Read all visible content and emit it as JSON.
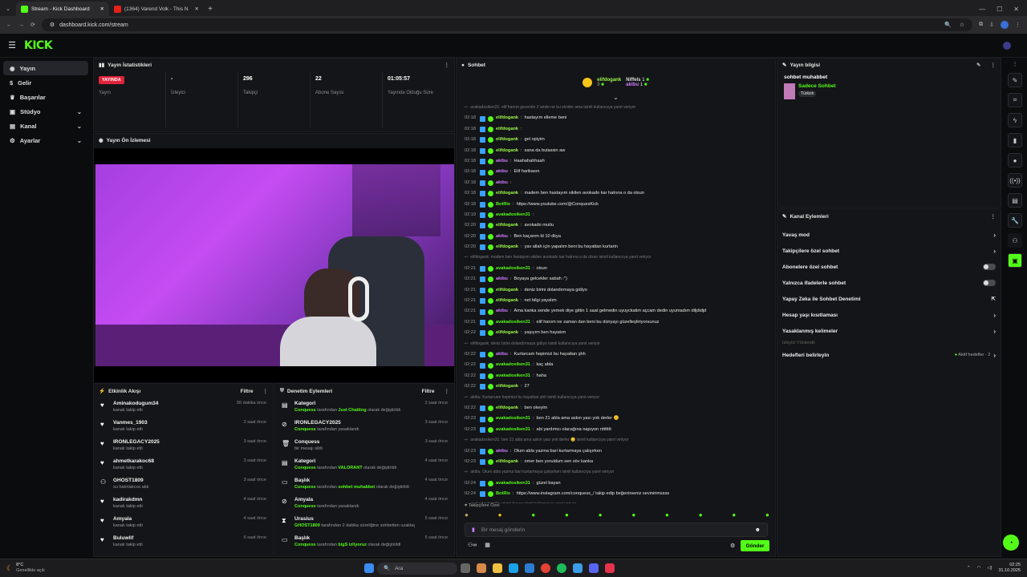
{
  "browser": {
    "tabs": [
      {
        "label": "Stream - Kick Dashboard",
        "active": true,
        "icon": "kick-icon"
      },
      {
        "label": "(1364) Varend Volk - This N",
        "active": false,
        "icon": "youtube-icon"
      }
    ],
    "url": "dashboard.kick.com/stream"
  },
  "header": {
    "logo": "KICK"
  },
  "sidebar": {
    "items": [
      {
        "label": "Yayın",
        "active": true,
        "chevron": false
      },
      {
        "label": "Gelir",
        "active": false,
        "chevron": false
      },
      {
        "label": "Başarılar",
        "active": false,
        "chevron": false
      },
      {
        "label": "Stüdyo",
        "active": false,
        "chevron": true
      },
      {
        "label": "Kanal",
        "active": false,
        "chevron": true
      },
      {
        "label": "Ayarlar",
        "active": false,
        "chevron": true
      }
    ]
  },
  "stats": {
    "title": "Yayın İstatistikleri",
    "items": [
      {
        "value": "YAYINDA",
        "label": "Yayın",
        "is_badge": true
      },
      {
        "value": "-",
        "label": "İzleyici"
      },
      {
        "value": "296",
        "label": "Takipçi"
      },
      {
        "value": "22",
        "label": "Abone Sayısı"
      },
      {
        "value": "01:05:57",
        "label": "Yayında Olduğu Süre"
      }
    ]
  },
  "preview": {
    "title": "Yayın Ön İzlemesi"
  },
  "activity": {
    "title": "Etkinlik Akışı",
    "filter": "Filtre",
    "items": [
      {
        "name": "Aminakodugum34",
        "sub": "kanalı takip etti",
        "time": "56 dakika önce",
        "icon": "heart-icon"
      },
      {
        "name": "Vanmes_1903",
        "sub": "kanalı takip etti",
        "time": "2 saat önce",
        "icon": "heart-icon"
      },
      {
        "name": "IRONLEGACY2025",
        "sub": "kanalı takip etti",
        "time": "3 saat önce",
        "icon": "heart-icon"
      },
      {
        "name": "ahmetkarakoc68",
        "sub": "kanalı takip etti",
        "time": "3 saat önce",
        "icon": "heart-icon"
      },
      {
        "name": "GHOST1809",
        "sub": "su hatırlatıcısı aldı",
        "time": "3 saat önce",
        "icon": "reward-icon"
      },
      {
        "name": "kadirakdmn",
        "sub": "kanalı takip etti",
        "time": "4 saat önce",
        "icon": "heart-icon"
      },
      {
        "name": "Amyala",
        "sub": "kanalı takip etti",
        "time": "4 saat önce",
        "icon": "heart-icon"
      },
      {
        "name": "Buluwlif",
        "sub": "kanalı takip etti",
        "time": "6 saat önce",
        "icon": "heart-icon"
      }
    ]
  },
  "moderation": {
    "title": "Denetim Eylemleri",
    "filter": "Filtre",
    "items": [
      {
        "name": "Kategori",
        "pre": "Conquess",
        "mid": " tarafından ",
        "hl": "Just Chatting",
        "post": " olarak değiştirildi",
        "time": "2 saat önce",
        "icon": "category-icon"
      },
      {
        "name": "IRONLEGACY2025",
        "pre": "Conquess",
        "mid": " tarafından yasaklandı",
        "hl": "",
        "post": "",
        "time": "3 saat önce",
        "icon": "ban-icon"
      },
      {
        "name": "Conquess",
        "pre": "",
        "mid": "bir mesajı sildi",
        "hl": "",
        "post": "",
        "time": "3 saat önce",
        "icon": "trash-icon"
      },
      {
        "name": "Kategori",
        "pre": "Conquess",
        "mid": " tarafından ",
        "hl": "VALORANT",
        "post": " olarak değiştirildi",
        "time": "4 saat önce",
        "icon": "category-icon"
      },
      {
        "name": "Başlık",
        "pre": "Conquess",
        "mid": " tarafından ",
        "hl": "sohbet muhabbet",
        "post": " olarak değiştirildi",
        "time": "4 saat önce",
        "icon": "title-icon"
      },
      {
        "name": "Amyala",
        "pre": "Conquess",
        "mid": " tarafından yasaklandı",
        "hl": "",
        "post": "",
        "time": "4 saat önce",
        "icon": "ban-icon"
      },
      {
        "name": "Urasius",
        "pre": "GHOST1809",
        "mid": " tarafından 2 dakika süreliğine sohbetten uzaklaştırıldı",
        "hl": "",
        "post": "",
        "time": "5 saat önce",
        "icon": "timeout-icon"
      },
      {
        "name": "Başlık",
        "pre": "Conquess",
        "mid": " tarafından ",
        "hl": "bigS izliyoruz",
        "post": " olarak değiştirildi",
        "time": "5 saat önce",
        "icon": "title-icon"
      }
    ]
  },
  "chat": {
    "title": "Sohbet",
    "leaders": [
      {
        "name": "elifdogank",
        "count": "3"
      },
      {
        "name": "Niffels",
        "count": "1"
      },
      {
        "name": "aktbu",
        "count": "1"
      }
    ],
    "messages": [
      {
        "sys": "avakadosiken31: elif hanım gecerdin 2 amile ne bu elcider ama isimli kullanıcıya yanıt veriyor"
      },
      {
        "time": "02:18",
        "user": "elifdogank",
        "u": "u1",
        "text": "hastayım elleme beni"
      },
      {
        "time": "02:18",
        "user": "elifdogank",
        "u": "u1",
        "text": ""
      },
      {
        "time": "02:18",
        "user": "elifdogank",
        "u": "u1",
        "text": "gel opiyim"
      },
      {
        "time": "02:18",
        "user": "elifdogank",
        "u": "u1",
        "text": "sana da bulassin aw"
      },
      {
        "time": "02:18",
        "user": "aktbu",
        "u": "u2",
        "text": "Haahahahhaah"
      },
      {
        "time": "02:18",
        "user": "aktbu",
        "u": "u2",
        "text": "Elif harikasın"
      },
      {
        "time": "02:18",
        "user": "aktbu",
        "u": "u2",
        "text": ""
      },
      {
        "time": "02:18",
        "user": "elifdogank",
        "u": "u1",
        "text": "madem ben hastayım sikilen avokado kar hatrına o da olsun"
      },
      {
        "time": "02:18",
        "user": "BotRix",
        "u": "u3",
        "text": "https://www.youtube.com/@ConquesKick"
      },
      {
        "time": "02:19",
        "user": "avakadosiken31",
        "u": "u3",
        "text": ""
      },
      {
        "time": "02:20",
        "user": "elifdogank",
        "u": "u1",
        "text": "avokado mutlu"
      },
      {
        "time": "02:20",
        "user": "aktbu",
        "u": "u2",
        "text": "Ben kaçarım bl 10 dkya"
      },
      {
        "time": "02:20",
        "user": "elifdogank",
        "u": "u1",
        "text": "yav allah için yapalım beni bu hayattan kurtarin"
      },
      {
        "sys": "elifdogank: madem ben hastayım sikilen avokado kar hatrına o da olsun isimli kullanıcıya yanıt veriyor"
      },
      {
        "time": "02:21",
        "user": "avakadosiken31",
        "u": "u3",
        "text": "olsun"
      },
      {
        "time": "02:21",
        "user": "aktbu",
        "u": "u2",
        "text": "Boyaya gelcekler sabah :\")"
      },
      {
        "time": "02:21",
        "user": "elifdogank",
        "u": "u1",
        "text": "deniz birini dolandırmaya gidiyo"
      },
      {
        "time": "02:21",
        "user": "elifdogank",
        "u": "u1",
        "text": "net bilgi yayalım"
      },
      {
        "time": "02:21",
        "user": "aktbu",
        "u": "u2",
        "text": "Ama kanka sende yemek diye gittin 1 saat gelmedin uyuyckatim açcam dedin uyumadım diljdidjd"
      },
      {
        "time": "02:21",
        "user": "avakadosiken31",
        "u": "u3",
        "text": "elif hanım ne zaman dan beni bu dünyayı güzelleştiriyorsunuz"
      },
      {
        "time": "02:22",
        "user": "elifdogank",
        "u": "u1",
        "text": "yaşıyım ben hayatım"
      },
      {
        "sys": "elifdogank: deniz birini dolandırmaya gidiyo isimli kullanıcıya yanıt veriyor"
      },
      {
        "time": "02:22",
        "user": "aktbu",
        "u": "u2",
        "text": "Kurtarcam hepimizi bu hayattan şhh"
      },
      {
        "time": "02:22",
        "user": "avakadosiken31",
        "u": "u3",
        "text": "kaç abla"
      },
      {
        "time": "02:22",
        "user": "avakadosiken31",
        "u": "u3",
        "text": "haha"
      },
      {
        "time": "02:22",
        "user": "elifdogank",
        "u": "u1",
        "text": "27"
      },
      {
        "sys": "aktbu: Kurtarcam hepimizi bu hayattan şhh isimli kullanıcıya yanıt veriyor"
      },
      {
        "time": "02:22",
        "user": "elifdogank",
        "u": "u1",
        "text": "ben okeyim"
      },
      {
        "time": "02:23",
        "user": "avakadosiken31",
        "u": "u3",
        "text": "ben 21 abla ama askın yası yok derler 😊"
      },
      {
        "time": "02:23",
        "user": "avakadosiken31",
        "u": "u3",
        "text": "abi yardımcı olacağına napıyon nttttttt"
      },
      {
        "sys": "avakadosiken31: ben 21 abla ama askın yası yok derler 😊 isimli kullanıcıya yanıt veriyor"
      },
      {
        "time": "02:23",
        "user": "aktbu",
        "u": "u2",
        "text": "Olum abla yazma bari kurtarmaya çalışırken"
      },
      {
        "time": "02:23",
        "user": "elifdogank",
        "u": "u1",
        "text": "omer ben yoruldum sen söv kanka"
      },
      {
        "sys": "aktbu: Olum abla yazma bari kurtarmaya çalışırken isimli kullanıcıya yanıt veriyor"
      },
      {
        "time": "02:24",
        "user": "avakadosiken31",
        "u": "u3",
        "text": "güzel bayan"
      },
      {
        "time": "02:24",
        "user": "BotRix",
        "u": "u3",
        "text": "https://www.instagram.com/conquess_/ takip edip beğenirseniz sevinirimssss"
      },
      {
        "sys": "avakadosiken31: güzel bayan isimli kullanıcıya yanıt veriyor"
      },
      {
        "time": "02:24",
        "user": "aktbu",
        "u": "u2",
        "text": "Kanka banayse hiç bulaşma r ye al"
      },
      {
        "time": "02:25",
        "user": "avakadosiken31",
        "u": "u3",
        "text": "yok reis ya elif hanım a"
      }
    ],
    "followers_only": "Takipçilere Özel",
    "input_placeholder": "Bir mesaj gönderin",
    "send": "Gönder"
  },
  "stream_info": {
    "title": "Yayın bilgisi",
    "stream_title": "sohbet muhabbet",
    "category": "Sadece Sohbet",
    "tag": "Türkish"
  },
  "channel_actions": {
    "title": "Kanal Eylemleri",
    "items": [
      {
        "label": "Yavaş mod",
        "kind": "chevron"
      },
      {
        "label": "Takipçilere özel sohbet",
        "kind": "chevron"
      },
      {
        "label": "Abonelere özel sohbet",
        "kind": "toggle"
      },
      {
        "label": "Yalnızca ifadelerle sohbet",
        "kind": "toggle"
      },
      {
        "label": "Yapay Zeka ile Sohbet Denetimi",
        "kind": "external"
      },
      {
        "label": "Hesap yaşı kısıtlaması",
        "kind": "chevron"
      },
      {
        "label": "Yasaklanmış kelimeler",
        "kind": "chevron"
      }
    ],
    "section": "İzleyici Yönlendir",
    "goals": "Hedefleri belirleyin",
    "goals_active": "Aktif hedefler · 2"
  },
  "taskbar": {
    "weather_temp": "8°C",
    "weather_desc": "Genellikle açık",
    "search": "Ara",
    "time": "02:25",
    "date": "31.10.2025"
  },
  "colors": {
    "accent": "#53fc18",
    "live": "#e0243b"
  }
}
